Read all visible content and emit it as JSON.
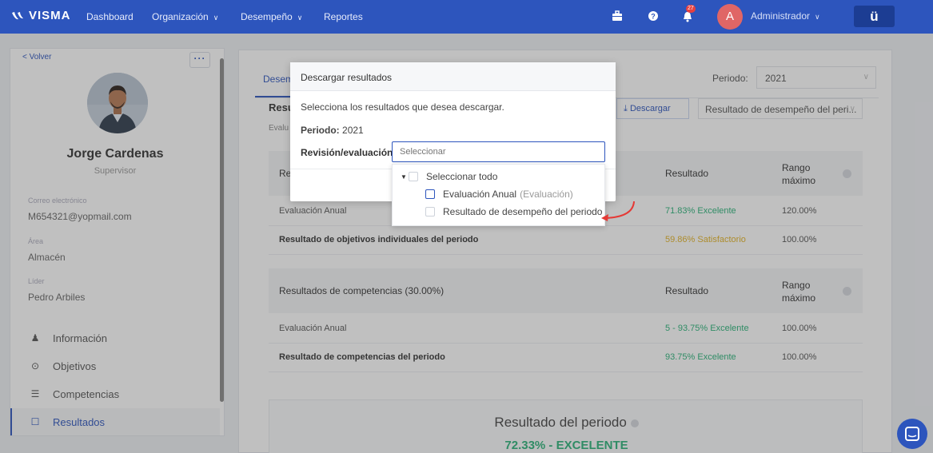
{
  "topbar": {
    "brand": "VISMA",
    "nav": [
      {
        "label": "Dashboard",
        "has_dropdown": false
      },
      {
        "label": "Organización",
        "has_dropdown": true
      },
      {
        "label": "Desempeño",
        "has_dropdown": true
      },
      {
        "label": "Reportes",
        "has_dropdown": false
      }
    ],
    "notification_count": "27",
    "avatar_initial": "A",
    "user_name": "Administrador",
    "app_button_label": "ü",
    "icons": [
      "briefcase-icon",
      "help-icon",
      "bell-icon",
      "chevron-down-icon"
    ]
  },
  "profile": {
    "back_label": "< Volver",
    "more_label": "···",
    "name": "Jorge Cardenas",
    "role": "Supervisor",
    "fields": [
      {
        "label": "Correo electrónico",
        "value": "M654321@yopmail.com"
      },
      {
        "label": "Área",
        "value": "Almacén"
      },
      {
        "label": "Líder",
        "value": "Pedro Arbiles"
      }
    ],
    "menu": [
      {
        "label": "Información",
        "icon": "person-icon",
        "active": false
      },
      {
        "label": "Objetivos",
        "icon": "target-icon",
        "active": false
      },
      {
        "label": "Competencias",
        "icon": "list-icon",
        "active": false
      },
      {
        "label": "Resultados",
        "icon": "clipboard-icon",
        "active": true
      }
    ]
  },
  "main": {
    "tab_label": "Desem",
    "periodo_label": "Periodo:",
    "periodo_value": "2021",
    "download_label": "Descargar",
    "result_select": "Resultado de desempeño del peri...",
    "heading_fragment": "Resu",
    "subheading_fragment": "Evalu",
    "objectives_table": {
      "header_fragment": "Re",
      "col_result": "Resultado",
      "col_range": "Rango máximo",
      "rows": [
        {
          "name": "Evaluación Anual",
          "result": "71.83% Excelente",
          "range": "120.00%",
          "bold": false,
          "color": "#2bb37a"
        },
        {
          "name": "Resultado de objetivos individuales del periodo",
          "result": "59.86% Satisfactorio",
          "range": "100.00%",
          "bold": true,
          "color": "#e3b326"
        }
      ]
    },
    "competencies_table": {
      "header": "Resultados de competencias (30.00%)",
      "col_result": "Resultado",
      "col_range": "Rango máximo",
      "rows": [
        {
          "name": "Evaluación Anual",
          "result": "5 - 93.75% Excelente",
          "range": "100.00%",
          "bold": false,
          "color": "#2bb37a"
        },
        {
          "name": "Resultado de competencias del periodo",
          "result": "93.75% Excelente",
          "range": "100.00%",
          "bold": true,
          "color": "#2bb37a"
        }
      ]
    },
    "summary": {
      "title": "Resultado del periodo",
      "value": "72.33% - EXCELENTE"
    }
  },
  "dialog": {
    "title": "Descargar resultados",
    "instructions": "Selecciona los resultados que desea descargar.",
    "periodo_label": "Periodo:",
    "periodo_value": "2021",
    "field_label": "Revisión/evaluación*",
    "field_placeholder": "Seleccionar",
    "options": {
      "select_all": "Seleccionar todo",
      "items": [
        {
          "label": "Evaluación Anual",
          "suffix": "(Evaluación)",
          "checked": false
        },
        {
          "label": "Resultado de desempeño del periodo",
          "suffix": "",
          "checked": false
        }
      ]
    }
  },
  "colors": {
    "brand": "#2d55bd",
    "success": "#2bb37a",
    "warning": "#e3b326",
    "annotation": "#e53935"
  }
}
